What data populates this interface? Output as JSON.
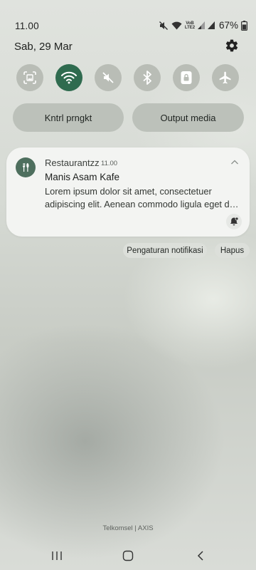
{
  "status_bar": {
    "time": "11.00",
    "network_label": "VoB LTE2",
    "battery": "67%",
    "icons": [
      "mute-icon",
      "wifi-icon",
      "signal-icon",
      "signal-icon",
      "battery-icon"
    ]
  },
  "header": {
    "date": "Sab, 29 Mar",
    "settings_icon": "gear-icon"
  },
  "quick_tiles": [
    {
      "name": "screen-capture",
      "icon": "screenshot-icon",
      "active": false
    },
    {
      "name": "wifi",
      "icon": "wifi-icon",
      "active": true
    },
    {
      "name": "sound",
      "icon": "mute-icon",
      "active": false
    },
    {
      "name": "bluetooth",
      "icon": "bluetooth-icon",
      "active": false
    },
    {
      "name": "rotation-lock",
      "icon": "lock-icon",
      "active": false
    },
    {
      "name": "airplane-mode",
      "icon": "airplane-icon",
      "active": false
    }
  ],
  "pill_buttons": {
    "device_control": "Kntrl prngkt",
    "media_output": "Output media"
  },
  "notification": {
    "app_name": "Restaurantzz",
    "time": "11.00",
    "title": "Manis Asam Kafe",
    "body_line1": "Lorem ipsum dolor sit amet, consectetuer",
    "body_line2": "adipiscing elit. Aenean commodo ligula eget dolor.",
    "app_icon": "fork-knife-icon",
    "bell_icon": "bell-snooze-icon"
  },
  "notification_actions": {
    "settings": "Pengaturan notifikasi",
    "clear": "Hapus"
  },
  "carrier": "Telkomsel | AXIS",
  "navbar": {
    "recents_icon": "recents-icon",
    "home_icon": "home-icon",
    "back_icon": "back-icon"
  },
  "colors": {
    "accent": "#2f6b4f",
    "app_icon_bg": "#4e6f5e",
    "card_bg": "#f3f4f2",
    "tile_bg": "#b9bdb6"
  }
}
